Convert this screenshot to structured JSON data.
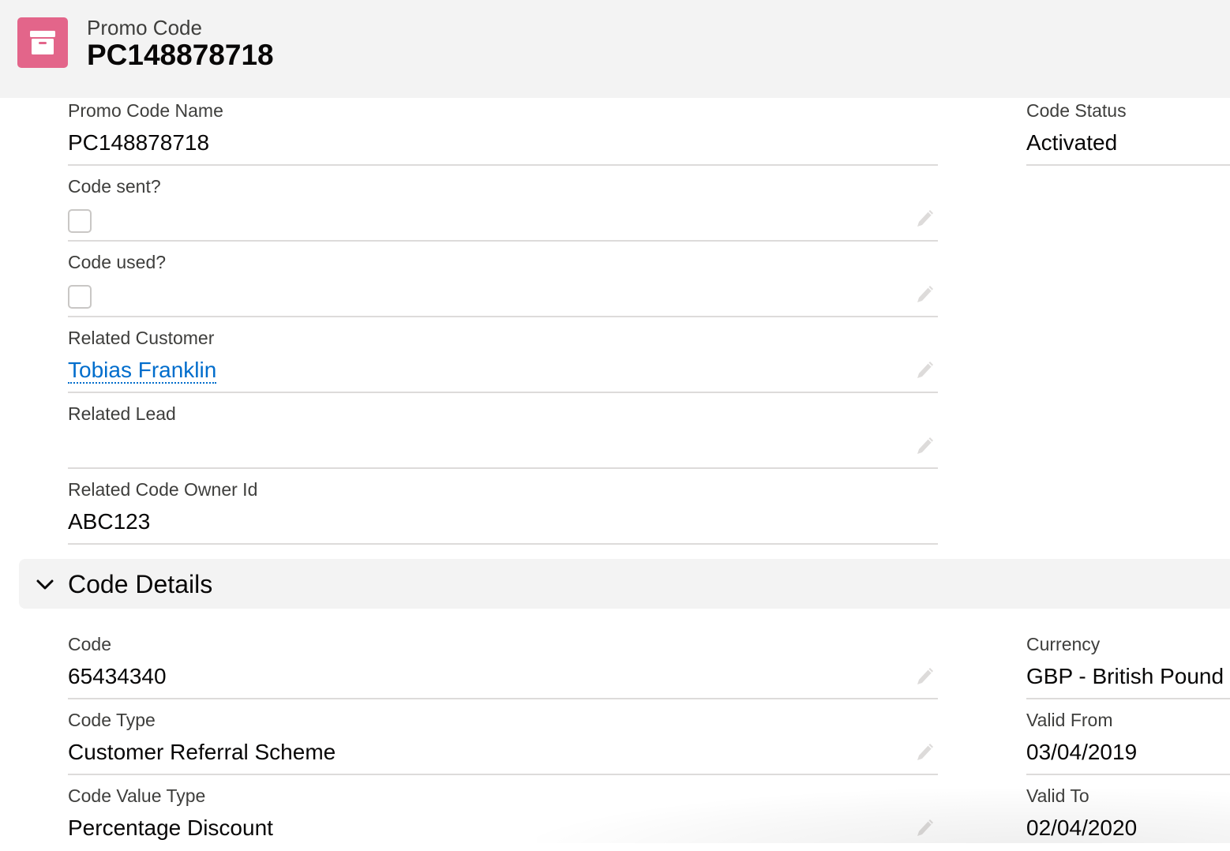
{
  "header": {
    "object_type": "Promo Code",
    "record_title": "PC148878718",
    "icon": "archive-box-icon",
    "icon_color": "#e3658a"
  },
  "fields_top_left": [
    {
      "label": "Promo Code Name",
      "value": "PC148878718",
      "type": "text",
      "editable": false
    },
    {
      "label": "Code sent?",
      "value": "",
      "type": "checkbox",
      "checked": false,
      "editable": true
    },
    {
      "label": "Code used?",
      "value": "",
      "type": "checkbox",
      "checked": false,
      "editable": true
    },
    {
      "label": "Related Customer",
      "value": "Tobias Franklin",
      "type": "link",
      "editable": true
    },
    {
      "label": "Related Lead",
      "value": "",
      "type": "text",
      "editable": true
    },
    {
      "label": "Related Code Owner Id",
      "value": "ABC123",
      "type": "text",
      "editable": false
    }
  ],
  "fields_top_right": [
    {
      "label": "Code Status",
      "value": "Activated",
      "type": "text",
      "editable": false
    }
  ],
  "section": {
    "title": "Code Details",
    "expanded": true
  },
  "fields_details_left": [
    {
      "label": "Code",
      "value": "65434340",
      "type": "text",
      "editable": true
    },
    {
      "label": "Code Type",
      "value": "Customer Referral Scheme",
      "type": "text",
      "editable": true
    },
    {
      "label": "Code Value Type",
      "value": "Percentage Discount",
      "type": "text",
      "editable": true
    }
  ],
  "fields_details_right": [
    {
      "label": "Currency",
      "value": "GBP - British Pound",
      "type": "text"
    },
    {
      "label": "Valid From",
      "value": "03/04/2019",
      "type": "text"
    },
    {
      "label": "Valid To",
      "value": "02/04/2020",
      "type": "text"
    }
  ],
  "colors": {
    "link": "#006dcc",
    "header_bg": "#f3f3f3",
    "divider": "#dddbda"
  }
}
